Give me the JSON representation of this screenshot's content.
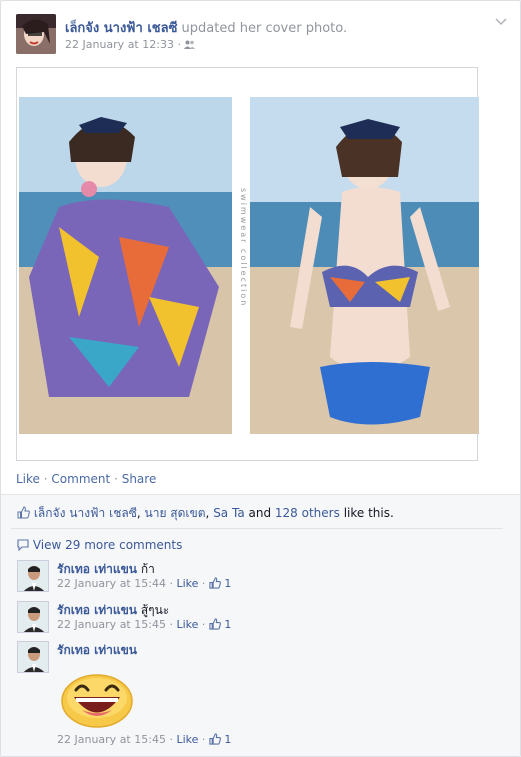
{
  "post": {
    "author": "เล็กจัง นางฟ้า เชลซี",
    "action": "updated her cover photo.",
    "time": "22 January at 12:33",
    "separator": "·",
    "photo_text": "swimwear collection"
  },
  "actions": {
    "like": "Like",
    "comment": "Comment",
    "share": "Share",
    "dot": "·"
  },
  "likes": {
    "name1": "เล็กจัง นางฟ้า เชลซี",
    "comma1": ",",
    "name2": "นาย สุดเขต",
    "comma2": ",",
    "name3": "Sa Ta",
    "and": "and",
    "others": "128 others",
    "suffix": "like this."
  },
  "view_more": "View 29 more comments",
  "comments": [
    {
      "name": "รักเทอ เท่าแขน",
      "text": "ก้า",
      "time": "22 January at 15:44",
      "like": "Like",
      "count": "1"
    },
    {
      "name": "รักเทอ เท่าแขน",
      "text": "สู้ๆนะ",
      "time": "22 January at 15:45",
      "like": "Like",
      "count": "1"
    },
    {
      "name": "รักเทอ เท่าแขน",
      "text": "",
      "time": "22 January at 15:45",
      "like": "Like",
      "count": "1"
    }
  ],
  "colors": {
    "link": "#3b5998",
    "muted": "#90949c",
    "sticker": "#f7c948"
  },
  "icons": [
    "chevron-down-icon",
    "friends-icon",
    "like-thumb-icon",
    "comment-bubble-icon",
    "smiley-sticker-icon"
  ]
}
